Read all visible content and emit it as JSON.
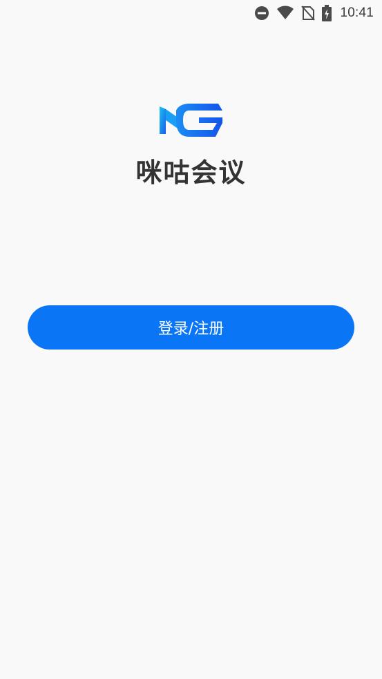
{
  "status_bar": {
    "time": "10:41",
    "icons": [
      "do-not-disturb-icon",
      "wifi-icon",
      "no-sim-icon",
      "battery-charging-icon"
    ]
  },
  "app": {
    "logo_icon": "mg-logo-icon",
    "title": "咪咕会议"
  },
  "actions": {
    "login_label": "登录/注册"
  },
  "colors": {
    "accent": "#0a76f6",
    "background": "#f9f9f9",
    "title_text": "#333333"
  }
}
